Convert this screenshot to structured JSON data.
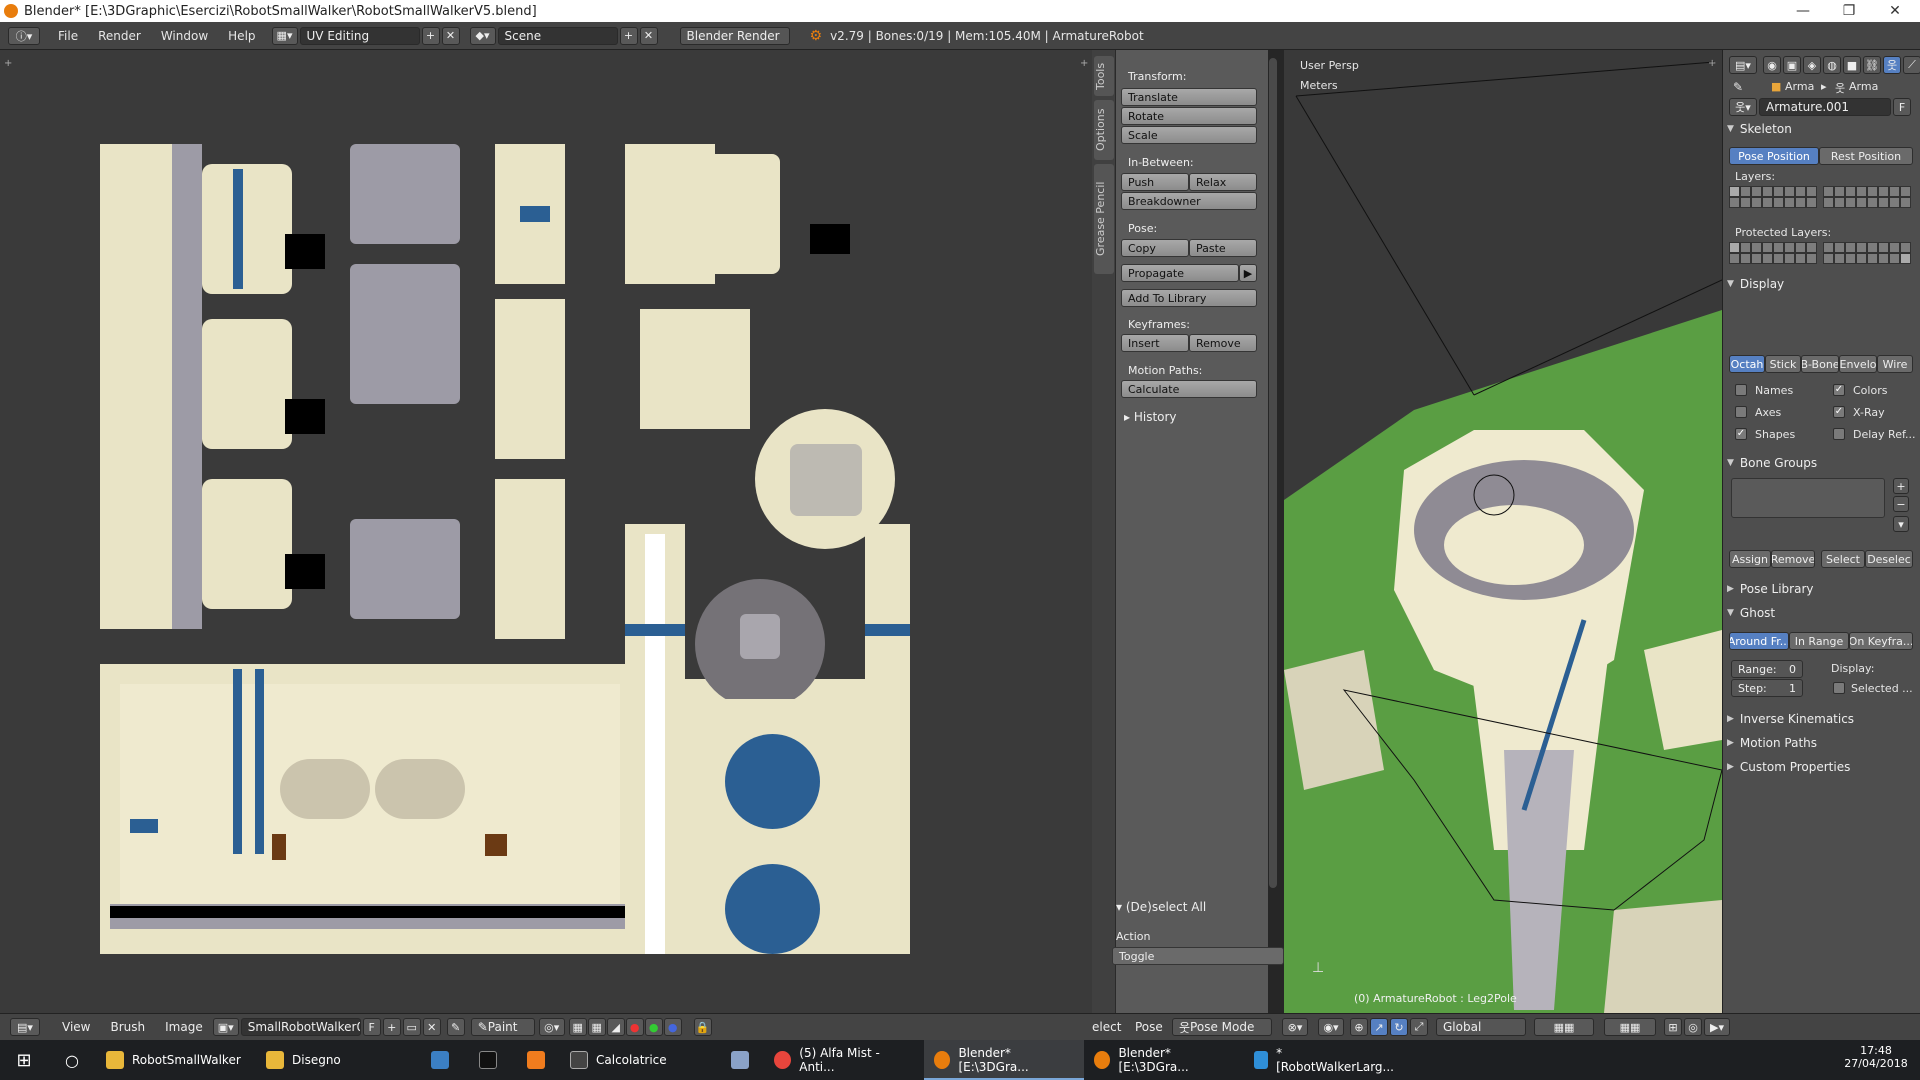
{
  "window": {
    "title": "Blender* [E:\\3DGraphic\\Esercizi\\RobotSmallWalker\\RobotSmallWalkerV5.blend]"
  },
  "menu": {
    "items": [
      "File",
      "Render",
      "Window",
      "Help"
    ]
  },
  "layout": {
    "name": "UV Editing"
  },
  "scene": {
    "name": "Scene"
  },
  "engine": {
    "name": "Blender Render"
  },
  "stats": "v2.79 | Bones:0/19 | Mem:105.40M | ArmatureRobot",
  "tool_tabs": [
    "Tools",
    "Options",
    "Grease Pencil"
  ],
  "tools": {
    "transform_label": "Transform:",
    "translate": "Translate",
    "rotate": "Rotate",
    "scale": "Scale",
    "inbetween_label": "In-Between:",
    "push": "Push",
    "relax": "Relax",
    "breakdowner": "Breakdowner",
    "pose_label": "Pose:",
    "copy": "Copy",
    "paste": "Paste",
    "propagate": "Propagate",
    "add_to_library": "Add To Library",
    "keyframes_label": "Keyframes:",
    "insert": "Insert",
    "remove": "Remove",
    "motion_paths_label": "Motion Paths:",
    "calculate": "Calculate",
    "history": "History",
    "deselect_all": "(De)select All",
    "action_label": "Action",
    "action_value": "Toggle"
  },
  "viewport": {
    "view_name": "User Persp",
    "units": "Meters",
    "object_info": "(0) ArmatureRobot : Leg2Pole"
  },
  "properties": {
    "breadcrumb_1": "Arma",
    "breadcrumb_2": "Arma",
    "armature_name": "Armature.001",
    "fake_user": "F",
    "skeleton": "Skeleton",
    "pose_position": "Pose Position",
    "rest_position": "Rest Position",
    "layers": "Layers:",
    "protected_layers": "Protected Layers:",
    "display": "Display",
    "display_modes": [
      "Octah",
      "Stick",
      "B-Bone",
      "Envelo",
      "Wire"
    ],
    "names": "Names",
    "colors": "Colors",
    "axes": "Axes",
    "xray": "X-Ray",
    "shapes": "Shapes",
    "delay_refresh": "Delay Ref...",
    "bone_groups": "Bone Groups",
    "assign": "Assign",
    "remove": "Remove",
    "select": "Select",
    "deselect": "Deselec",
    "pose_library": "Pose Library",
    "ghost": "Ghost",
    "ghost_modes": [
      "Around Fr...",
      "In Range",
      "On Keyfra..."
    ],
    "range_label": "Range:",
    "range_value": "0",
    "step_label": "Step:",
    "step_value": "1",
    "display_label": "Display:",
    "selected": "Selected ...",
    "inverse_kinematics": "Inverse Kinematics",
    "motion_paths": "Motion Paths",
    "custom_properties": "Custom Properties"
  },
  "uv_footer": {
    "view": "View",
    "brush": "Brush",
    "image": "Image",
    "image_name": "SmallRobotWalker0...",
    "fake": "F",
    "paint": "Paint"
  },
  "vp_footer": {
    "select": "elect",
    "pose": "Pose",
    "mode": "Pose Mode",
    "orientation": "Global"
  },
  "taskbar": {
    "items": [
      "RobotSmallWalker",
      "Disegno",
      "Calcolatrice",
      "(5) Alfa Mist - Anti...",
      "Blender* [E:\\3DGra...",
      "Blender* [E:\\3DGra...",
      "*[RobotWalkerLarg..."
    ],
    "time": "17:48",
    "date": "27/04/2018"
  },
  "colors": {
    "accent": "#5680c2",
    "header": "#444444",
    "panel": "#4e4e4e",
    "blender_orange": "#e87d0d"
  }
}
